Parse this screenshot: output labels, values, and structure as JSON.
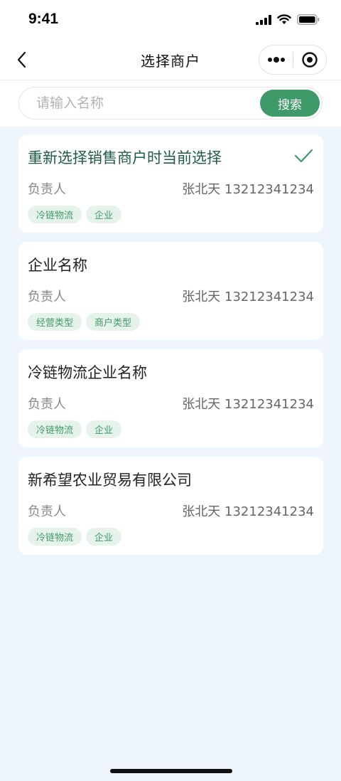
{
  "status_bar": {
    "time": "9:41"
  },
  "nav": {
    "title": "选择商户"
  },
  "search": {
    "placeholder": "请输入名称",
    "button_label": "搜索"
  },
  "merchants": [
    {
      "name": "重新选择销售商户时当前选择",
      "contact_label": "负责人",
      "contact": "张北天 13212341234",
      "tags": [
        "冷链物流",
        "企业"
      ],
      "selected": true
    },
    {
      "name": "企业名称",
      "contact_label": "负责人",
      "contact": "张北天 13212341234",
      "tags": [
        "经营类型",
        "商户类型"
      ],
      "selected": false
    },
    {
      "name": "冷链物流企业名称",
      "contact_label": "负责人",
      "contact": "张北天 13212341234",
      "tags": [
        "冷链物流",
        "企业"
      ],
      "selected": false
    },
    {
      "name": "新希望农业贸易有限公司",
      "contact_label": "负责人",
      "contact": "张北天 13212341234",
      "tags": [
        "冷链物流",
        "企业"
      ],
      "selected": false
    }
  ],
  "colors": {
    "accent": "#3f9a6a",
    "selected_title": "#1f5b45",
    "tag_bg": "#e5f3ea",
    "page_bg": "#eef5fd"
  }
}
